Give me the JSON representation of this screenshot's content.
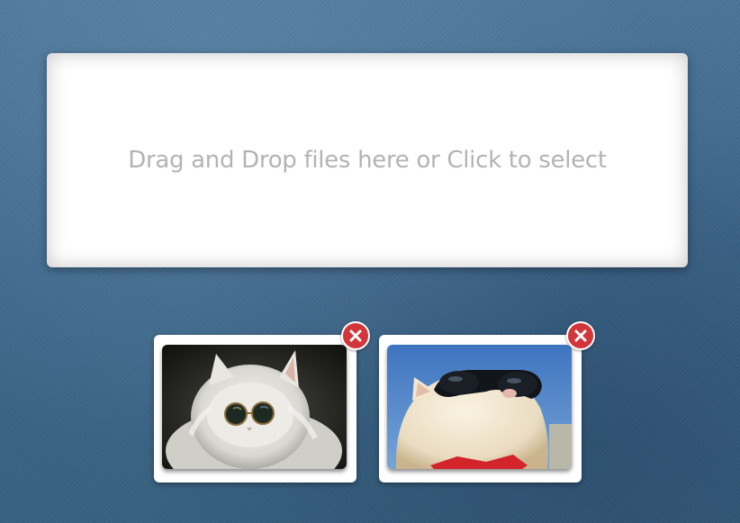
{
  "dropzone": {
    "text": "Drag and Drop files here or Click to select"
  },
  "previews": [
    {
      "subject": "white-cat-round-sunglasses",
      "remove_icon": "close-icon"
    },
    {
      "subject": "white-cat-sunglasses-sky",
      "remove_icon": "close-icon"
    }
  ],
  "colors": {
    "background": "#3f6a8f",
    "dropzone_bg": "#ffffff",
    "dropzone_text": "#b3b3b3",
    "remove_button": "#d2353a"
  }
}
